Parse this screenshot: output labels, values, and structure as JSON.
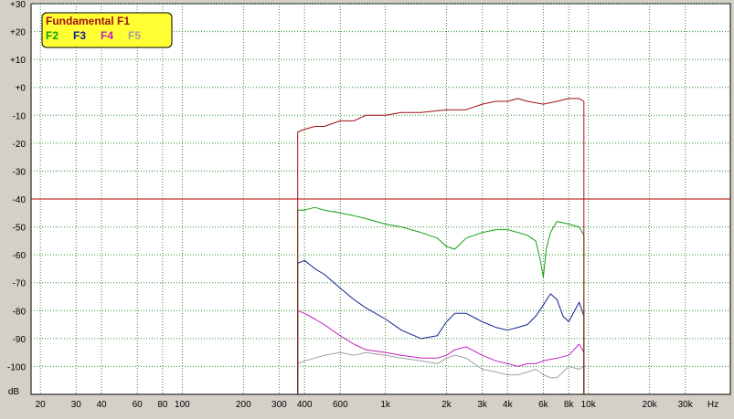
{
  "chart_data": {
    "type": "line",
    "xlabel": "Hz",
    "ylabel": "dB",
    "x_scale": "log",
    "xlim": [
      18,
      50000
    ],
    "ylim": [
      -110,
      30
    ],
    "x_ticks": [
      20,
      30,
      40,
      60,
      80,
      100,
      200,
      300,
      400,
      600,
      1000,
      2000,
      3000,
      4000,
      6000,
      8000,
      10000,
      20000,
      30000
    ],
    "x_tick_labels": [
      "20",
      "30",
      "40",
      "60",
      "80",
      "100",
      "200",
      "300",
      "400",
      "600",
      "1k",
      "2k",
      "3k",
      "4k",
      "6k",
      "8k",
      "10k",
      "20k",
      "30k"
    ],
    "y_ticks": [
      30,
      20,
      10,
      0,
      -10,
      -20,
      -30,
      -40,
      -50,
      -60,
      -70,
      -80,
      -90,
      -100
    ],
    "y_tick_labels": [
      "+30",
      "+20",
      "+10",
      "+0",
      "-10",
      "-20",
      "-30",
      "-40",
      "-50",
      "-60",
      "-70",
      "-80",
      "-90",
      "-100"
    ],
    "grid": true,
    "reference_line": {
      "y": -40,
      "color": "#b00000"
    },
    "legend": {
      "placement": "top-left",
      "title": "Fundamental F1",
      "items": [
        "F2",
        "F3",
        "F4",
        "F5"
      ]
    },
    "series": [
      {
        "name": "F1",
        "color": "#a01010",
        "x": [
          370,
          400,
          450,
          500,
          600,
          700,
          800,
          1000,
          1200,
          1500,
          2000,
          2500,
          3000,
          3500,
          4000,
          4500,
          5000,
          6000,
          7000,
          8000,
          9000,
          9500
        ],
        "y": [
          -16,
          -15,
          -14,
          -14,
          -12,
          -12,
          -10,
          -10,
          -9,
          -9,
          -8,
          -8,
          -6,
          -5,
          -5,
          -4,
          -5,
          -6,
          -5,
          -4,
          -4,
          -5
        ]
      },
      {
        "name": "F2",
        "color": "#10a010",
        "x": [
          370,
          400,
          450,
          500,
          600,
          700,
          800,
          1000,
          1200,
          1500,
          1800,
          2000,
          2200,
          2500,
          3000,
          3500,
          4000,
          4500,
          5000,
          5500,
          5800,
          6000,
          6200,
          6500,
          7000,
          8000,
          9000,
          9500
        ],
        "y": [
          -44,
          -44,
          -43,
          -44,
          -45,
          -46,
          -47,
          -49,
          -50,
          -52,
          -54,
          -57,
          -58,
          -54,
          -52,
          -51,
          -51,
          -52,
          -53,
          -55,
          -62,
          -68,
          -58,
          -52,
          -48,
          -49,
          -50,
          -53
        ]
      },
      {
        "name": "F3",
        "color": "#102090",
        "x": [
          370,
          400,
          450,
          500,
          600,
          700,
          800,
          1000,
          1200,
          1500,
          1800,
          2000,
          2200,
          2500,
          3000,
          3500,
          4000,
          4500,
          5000,
          5500,
          6000,
          6500,
          7000,
          7500,
          8000,
          9000,
          9500
        ],
        "y": [
          -63,
          -62,
          -65,
          -67,
          -72,
          -76,
          -79,
          -83,
          -87,
          -90,
          -89,
          -84,
          -81,
          -81,
          -84,
          -86,
          -87,
          -86,
          -85,
          -82,
          -78,
          -74,
          -76,
          -82,
          -84,
          -77,
          -82
        ]
      },
      {
        "name": "F4",
        "color": "#c020c0",
        "x": [
          370,
          400,
          450,
          500,
          600,
          700,
          800,
          1000,
          1200,
          1500,
          1800,
          2000,
          2200,
          2500,
          3000,
          3500,
          4000,
          4500,
          5000,
          5500,
          6000,
          7000,
          8000,
          9000,
          9500
        ],
        "y": [
          -80,
          -81,
          -83,
          -85,
          -89,
          -92,
          -94,
          -95,
          -96,
          -97,
          -97,
          -96,
          -94,
          -93,
          -96,
          -98,
          -99,
          -100,
          -99,
          -99,
          -98,
          -97,
          -96,
          -92,
          -95
        ]
      },
      {
        "name": "F5",
        "color": "#a0a0a0",
        "x": [
          370,
          400,
          450,
          500,
          600,
          700,
          800,
          1000,
          1200,
          1500,
          1800,
          2000,
          2200,
          2500,
          3000,
          3500,
          4000,
          4500,
          5000,
          5500,
          6000,
          6500,
          7000,
          7500,
          8000,
          9000,
          9500
        ],
        "y": [
          -99,
          -98,
          -97,
          -96,
          -95,
          -96,
          -95,
          -96,
          -97,
          -98,
          -99,
          -97,
          -96,
          -97,
          -101,
          -102,
          -103,
          -103,
          -102,
          -101,
          -103,
          -104,
          -104,
          -102,
          -100,
          -101,
          -100
        ]
      }
    ]
  }
}
